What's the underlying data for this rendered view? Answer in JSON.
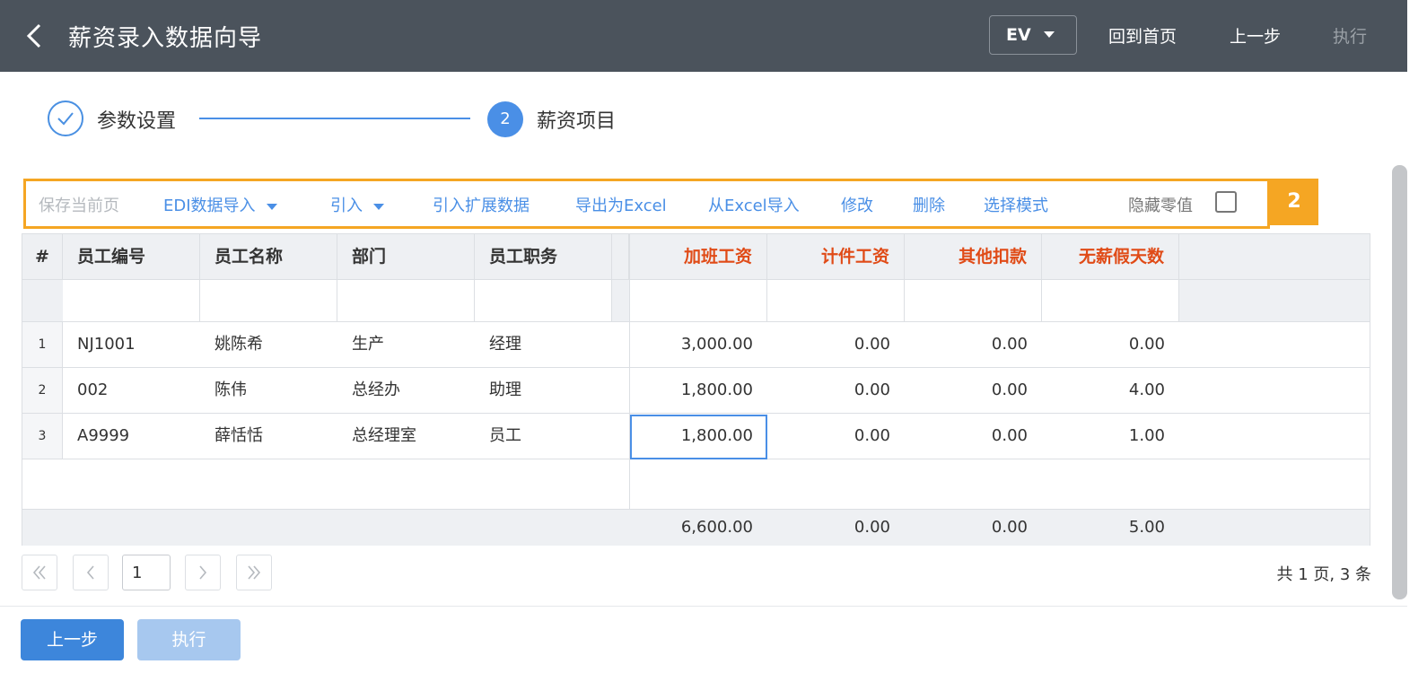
{
  "header": {
    "title": "薪资录入数据向导",
    "ev_select": "EV",
    "home_link": "回到首页",
    "prev_link": "上一步",
    "execute_link": "执行"
  },
  "steps": [
    {
      "label": "参数设置",
      "state": "done"
    },
    {
      "number": "2",
      "label": "薪资项目",
      "state": "active"
    }
  ],
  "toolbar": {
    "save_page": "保存当前页",
    "edi_import": "EDI数据导入",
    "import": "引入",
    "import_ext": "引入扩展数据",
    "export_excel": "导出为Excel",
    "import_excel": "从Excel导入",
    "edit": "修改",
    "delete": "删除",
    "select_mode": "选择模式",
    "hide_zero": "隐藏零值",
    "hide_zero_checked": false,
    "marker": "2",
    "accent_color": "#f5a623"
  },
  "table": {
    "columns": [
      "#",
      "员工编号",
      "员工名称",
      "部门",
      "员工职务",
      "加班工资",
      "计件工资",
      "其他扣款",
      "无薪假天数"
    ],
    "rows": [
      {
        "idx": "1",
        "code": "NJ1001",
        "name": "姚陈希",
        "dept": "生产",
        "title": "经理",
        "overtime": "3,000.00",
        "piece": "0.00",
        "deduct": "0.00",
        "unpaid": "0.00"
      },
      {
        "idx": "2",
        "code": "002",
        "name": "陈伟",
        "dept": "总经办",
        "title": "助理",
        "overtime": "1,800.00",
        "piece": "0.00",
        "deduct": "0.00",
        "unpaid": "4.00"
      },
      {
        "idx": "3",
        "code": "A9999",
        "name": "薛恬恬",
        "dept": "总经理室",
        "title": "员工",
        "overtime": "1,800.00",
        "piece": "0.00",
        "deduct": "0.00",
        "unpaid": "1.00"
      }
    ],
    "totals": {
      "overtime": "6,600.00",
      "piece": "0.00",
      "deduct": "0.00",
      "unpaid": "5.00"
    },
    "numeric_header_color": "#e04b17"
  },
  "pager": {
    "current_page": "1",
    "info": "共 1 页, 3 条"
  },
  "footer": {
    "prev_button": "上一步",
    "execute_button": "执行"
  }
}
